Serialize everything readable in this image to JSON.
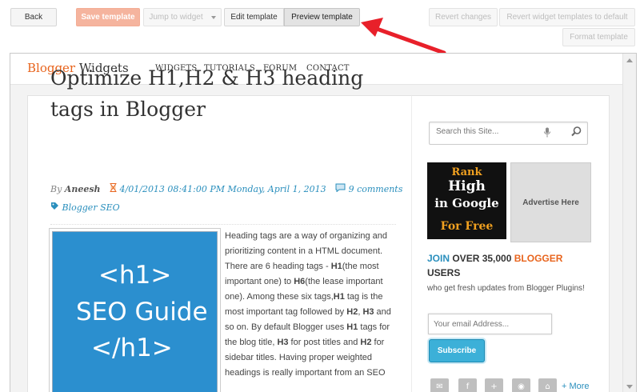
{
  "toolbar": {
    "back": "Back",
    "save": "Save template",
    "jump": "Jump to widget",
    "edit": "Edit template",
    "preview": "Preview template",
    "revert_changes": "Revert changes",
    "revert_widgets": "Revert widget templates to default",
    "format": "Format template"
  },
  "site": {
    "logo_accent": "Blogger",
    "logo_rest": " Widgets",
    "nav": [
      "WIDGETS",
      "TUTORIALS",
      "FORUM",
      "CONTACT"
    ]
  },
  "post": {
    "title": "Optimize H1,H2 & H3 heading tags in Blogger",
    "author_prefix": "By ",
    "author": "Aneesh",
    "date": "4/01/2013 08:41:00 PM Monday, April 1, 2013",
    "comments": "9 comments",
    "label": "Blogger SEO",
    "image_lines": [
      "<h1>",
      "SEO Guide",
      "</h1>"
    ],
    "body": {
      "p1": "Heading tags are a way of organizing and prioritizing content in a HTML document. There are 6 heading tags - ",
      "h1a": "H1",
      "p2": "(the most important one) to ",
      "h6": "H6",
      "p3": "(the lease important one). Among these six tags,",
      "h1b": "H1",
      "p4": " tag is the most important tag followed by ",
      "h2a": "H2",
      "p5": ", ",
      "h3a": "H3",
      "p6": " and so on. By default Blogger uses ",
      "h1c": "H1",
      "p7": " tags for the blog title, ",
      "h3b": "H3",
      "p8": " for post titles and ",
      "h2b": "H2",
      "p9": " for sidebar titles. Having proper weighted headings is really important from an SEO"
    }
  },
  "sidebar": {
    "search_placeholder": "Search this Site...",
    "rank_lines": [
      "Rank",
      "High",
      "in Google",
      "For Free"
    ],
    "advertise": "Advertise Here",
    "join_word": "JOIN",
    "join_count": " OVER 35,000 ",
    "join_blogger": "BLOGGER",
    "join_users": "USERS",
    "join_sub": "who get fresh updates from Blogger Plugins!",
    "email_placeholder": "Your email Address...",
    "subscribe": "Subscribe",
    "more": "+ More"
  },
  "colors": {
    "accent_orange": "#e8641d",
    "link_blue": "#2a8fbd",
    "image_blue": "#2b8fcf",
    "arrow_red": "#e8202a"
  },
  "icons": [
    "hourglass-icon",
    "comment-icon",
    "tag-icon",
    "microphone-icon",
    "search-icon",
    "email-icon",
    "facebook-icon",
    "google-plus-icon",
    "rss-icon",
    "home-icon",
    "chevron-down-icon"
  ]
}
